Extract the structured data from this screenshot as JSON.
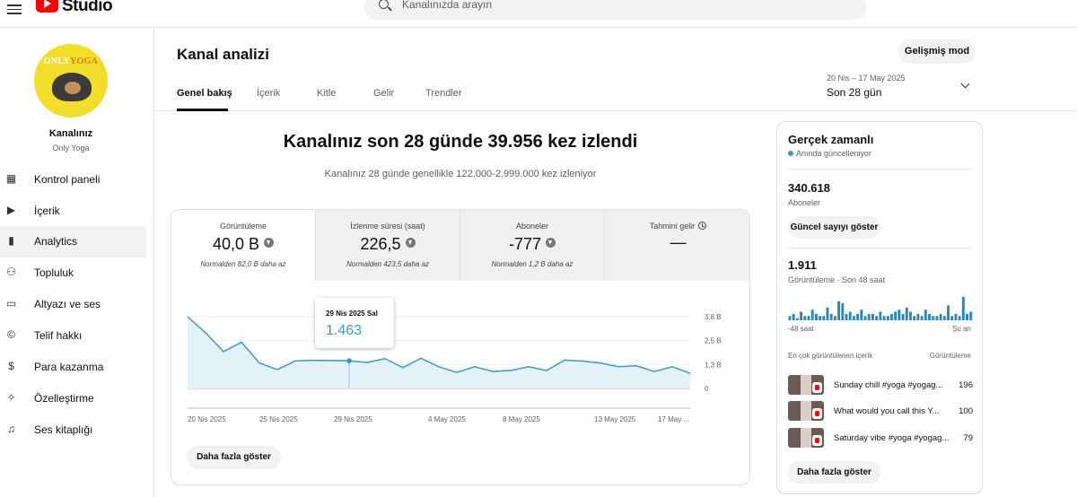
{
  "app": {
    "brand": "Studio"
  },
  "search": {
    "placeholder": "Kanalınızda arayın"
  },
  "channel": {
    "name": "Kanalınız",
    "handle": "Only Yoga",
    "logo_text": "ONLY",
    "logo_text_accent": "YOGA"
  },
  "sidebar": {
    "items": [
      {
        "label": "Kontrol paneli",
        "icon": "dashboard-icon"
      },
      {
        "label": "İçerik",
        "icon": "content-icon"
      },
      {
        "label": "Analytics",
        "icon": "analytics-icon",
        "active": true
      },
      {
        "label": "Topluluk",
        "icon": "community-icon"
      },
      {
        "label": "Altyazı ve ses",
        "icon": "subtitles-icon"
      },
      {
        "label": "Telif hakkı",
        "icon": "copyright-icon"
      },
      {
        "label": "Para kazanma",
        "icon": "dollar-icon"
      },
      {
        "label": "Özelleştirme",
        "icon": "magic-wand-icon"
      },
      {
        "label": "Ses kitaplığı",
        "icon": "audio-library-icon"
      }
    ]
  },
  "header": {
    "title": "Kanal analizi",
    "advanced_button": "Gelişmiş mod",
    "tabs": [
      "Genel bakış",
      "İçerik",
      "Kitle",
      "Gelir",
      "Trendler"
    ],
    "date_range": "20 Nis – 17 May 2025",
    "date_label": "Son 28 gün"
  },
  "summary": {
    "headline": "Kanalınız son 28 günde 39.956 kez izlendi",
    "subline": "Kanalınız 28 günde genellikle 122.000-2.999.000 kez izleniyor"
  },
  "metrics": [
    {
      "label": "Görüntüleme",
      "value": "40,0 B",
      "note": "Normalden 82,0 B daha az"
    },
    {
      "label": "İzlenme süresi (saat)",
      "value": "226,5",
      "note": "Normalden 423,5 daha az"
    },
    {
      "label": "Aboneler",
      "value": "-777",
      "note": "Normalden 1,2 B daha az"
    },
    {
      "label": "Tahmini gelir",
      "value": "—",
      "note": ""
    }
  ],
  "chart": {
    "tooltip_date": "29 Nis 2025 Sal",
    "tooltip_value": "1.463",
    "more_button": "Daha fazla göster"
  },
  "chart_data": {
    "type": "area",
    "x_tick_labels": [
      "20 Nis 2025",
      "25 Nis 2025",
      "29 Nis 2025",
      "4 May 2025",
      "8 May 2025",
      "13 May 2025",
      "17 May ..."
    ],
    "y_tick_labels": [
      "3,8 B",
      "2,5 B",
      "1,3 B",
      "0"
    ],
    "ylim": [
      0,
      3800
    ],
    "values": [
      3800,
      2950,
      1950,
      2450,
      1350,
      1000,
      1460,
      1490,
      1480,
      1463,
      1380,
      1580,
      1100,
      1600,
      1150,
      850,
      1150,
      900,
      950,
      1150,
      950,
      1500,
      1450,
      1350,
      1150,
      1200,
      900,
      1150,
      800
    ],
    "color": "#3a9bc2"
  },
  "realtime": {
    "title": "Gerçek zamanlı",
    "live_label": "Anında güncelleniyor",
    "subscribers": "340.618",
    "subscribers_label": "Aboneler",
    "show_count_button": "Güncel sayıyı göster",
    "views": "1.911",
    "views_label": "Görüntüleme · Son 48 saat",
    "axis_start": "-48 saat",
    "axis_end": "Şu an",
    "top_content_label": "En çok görüntülenen içerik",
    "top_views_label": "Görüntüleme",
    "items": [
      {
        "title": "Sunday chill #yoga #yogag...",
        "views": "196"
      },
      {
        "title": "What would you call this Y...",
        "views": "100"
      },
      {
        "title": "Saturday vibe #yoga #yogag...",
        "views": "79"
      }
    ],
    "more_button": "Daha fazla göster",
    "spark_values": [
      2,
      3,
      1,
      4,
      2,
      2,
      5,
      3,
      2,
      2,
      6,
      3,
      2,
      9,
      8,
      3,
      4,
      2,
      3,
      5,
      2,
      3,
      3,
      2,
      4,
      2,
      2,
      3,
      4,
      5,
      3,
      6,
      4,
      2,
      3,
      2,
      5,
      3,
      2,
      2,
      3,
      2,
      7,
      2,
      3,
      2,
      11,
      3,
      4
    ]
  }
}
